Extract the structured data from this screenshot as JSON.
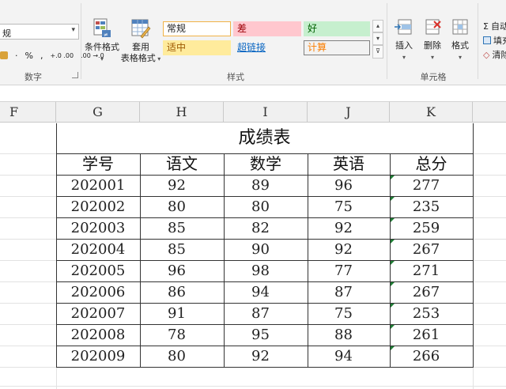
{
  "ribbon": {
    "number_group": {
      "format_value": "规",
      "row_items": [
        "·",
        "%",
        ",",
        "+.0 .00",
        ".00 →.0"
      ],
      "label": "数字"
    },
    "styles_group": {
      "conditional_format": "条件格式",
      "format_as_table_1": "套用",
      "format_as_table_2": "表格格式",
      "gallery": [
        "常规",
        "差",
        "好",
        "适中",
        "超链接",
        "计算"
      ],
      "label": "样式"
    },
    "cells_group": {
      "insert": "插入",
      "delete": "删除",
      "format": "格式",
      "label": "单元格"
    },
    "editing_group": {
      "autosum": "自动",
      "fill": "填充",
      "clear": "清除"
    }
  },
  "columns": [
    "F",
    "G",
    "H",
    "I",
    "J",
    "K"
  ],
  "table": {
    "title": "成绩表",
    "headers": [
      "学号",
      "语文",
      "数学",
      "英语",
      "总分"
    ],
    "rows": [
      [
        "202001",
        "92",
        "89",
        "96",
        "277"
      ],
      [
        "202002",
        "80",
        "80",
        "75",
        "235"
      ],
      [
        "202003",
        "85",
        "82",
        "92",
        "259"
      ],
      [
        "202004",
        "85",
        "90",
        "92",
        "267"
      ],
      [
        "202005",
        "96",
        "98",
        "77",
        "271"
      ],
      [
        "202006",
        "86",
        "94",
        "87",
        "267"
      ],
      [
        "202007",
        "91",
        "87",
        "75",
        "253"
      ],
      [
        "202008",
        "78",
        "95",
        "88",
        "261"
      ],
      [
        "202009",
        "80",
        "92",
        "94",
        "266"
      ]
    ]
  },
  "colors": {
    "style_bad_bg": "#ffc7ce",
    "style_good_bg": "#c6efce",
    "style_neutral_bg": "#ffeb9c",
    "style_calc_border": "#7f7f7f",
    "style_calc_text": "#fa7d00",
    "style_bad_text": "#9c0006",
    "hyperlink": "#0563c1",
    "number_stored_as_text_marker": "#1e7e34"
  }
}
